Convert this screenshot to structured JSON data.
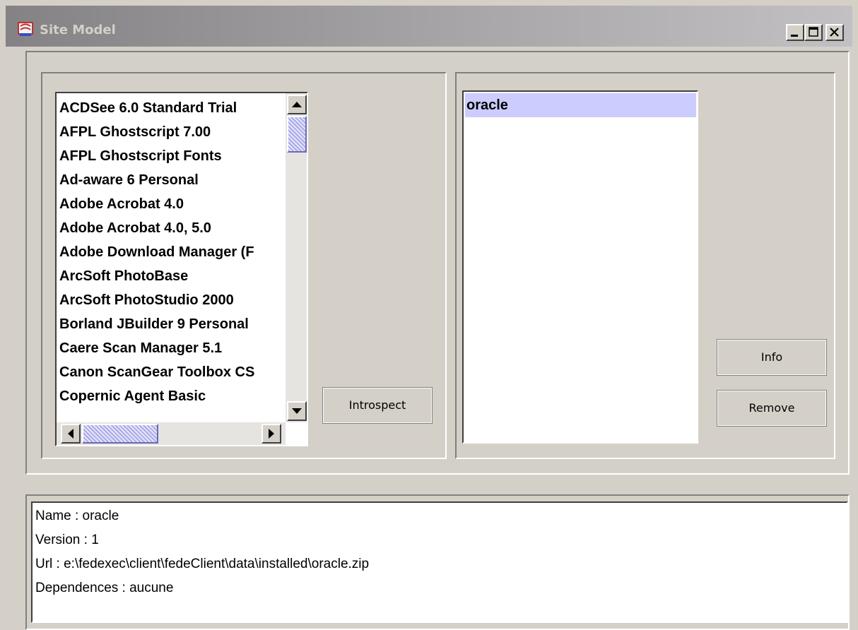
{
  "window": {
    "title": "Site Model",
    "controls": [
      "minimize",
      "maximize",
      "close"
    ]
  },
  "available_list": {
    "items": [
      "ACDSee 6.0 Standard Trial",
      "AFPL Ghostscript 7.00",
      "AFPL Ghostscript Fonts",
      "Ad-aware 6 Personal",
      "Adobe Acrobat 4.0",
      "Adobe Acrobat 4.0, 5.0",
      "Adobe Download Manager (F",
      "ArcSoft PhotoBase",
      "ArcSoft PhotoStudio 2000",
      "Borland JBuilder 9 Personal",
      "Caere Scan Manager 5.1",
      "Canon ScanGear Toolbox CS",
      "Copernic Agent Basic"
    ]
  },
  "buttons": {
    "introspect": "Introspect",
    "info": "Info",
    "remove": "Remove"
  },
  "installed_list": {
    "items": [
      "oracle"
    ],
    "selected": "oracle"
  },
  "details": {
    "lines": [
      "Name : oracle",
      "Version : 1",
      "Url : e:\\fedexec\\client\\fedeClient\\data\\installed\\oracle.zip",
      "Dependences : aucune"
    ]
  }
}
